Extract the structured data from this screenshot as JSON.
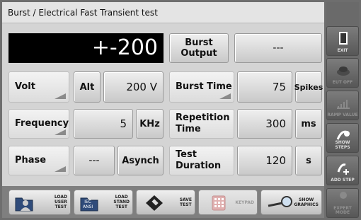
{
  "title": "Burst / Electrical Fast Transient test",
  "display_value": "+-200",
  "burst_output_label": "Burst\nOutput",
  "status_value": "---",
  "rows": {
    "volt": {
      "label": "Volt",
      "mode": "Alt",
      "value": "200 V"
    },
    "frequency": {
      "label": "Frequency",
      "value": "5",
      "unit": "KHz"
    },
    "phase": {
      "label": "Phase",
      "value": "---",
      "mode": "Asynch"
    },
    "burst_time": {
      "label": "Burst Time",
      "value": "75",
      "unit": "Spikes"
    },
    "repetition_time": {
      "label": "Repetition\nTime",
      "value": "300",
      "unit": "ms"
    },
    "test_duration": {
      "label": "Test\nDuration",
      "value": "120",
      "unit": "s"
    }
  },
  "bottom_buttons": [
    {
      "label": "LOAD\nUSER\nTEST",
      "icon": "folder-user-icon"
    },
    {
      "label": "LOAD\nSTAND\nTEST",
      "icon": "folder-iec-icon",
      "icon_text": "IEC\nANSI"
    },
    {
      "label": "SAVE\nTEST",
      "icon": "diskette-icon"
    },
    {
      "label": "KEYPAD",
      "icon": "keypad-icon"
    },
    {
      "label": "SHOW\nGRAPHICS",
      "icon": "magnifier-icon"
    }
  ],
  "side_buttons": [
    {
      "label": "EXIT",
      "icon": "door-icon"
    },
    {
      "label": "EUT OFF",
      "icon": "power-button-icon"
    },
    {
      "label": "RAMP VALUE",
      "icon": "ramp-icon"
    },
    {
      "label": "SHOW STEPS",
      "icon": "steps-icon"
    },
    {
      "label": "ADD STEP",
      "icon": "add-step-icon"
    },
    {
      "label": "EXPERT\nMODE",
      "icon": "expert-icon"
    }
  ]
}
